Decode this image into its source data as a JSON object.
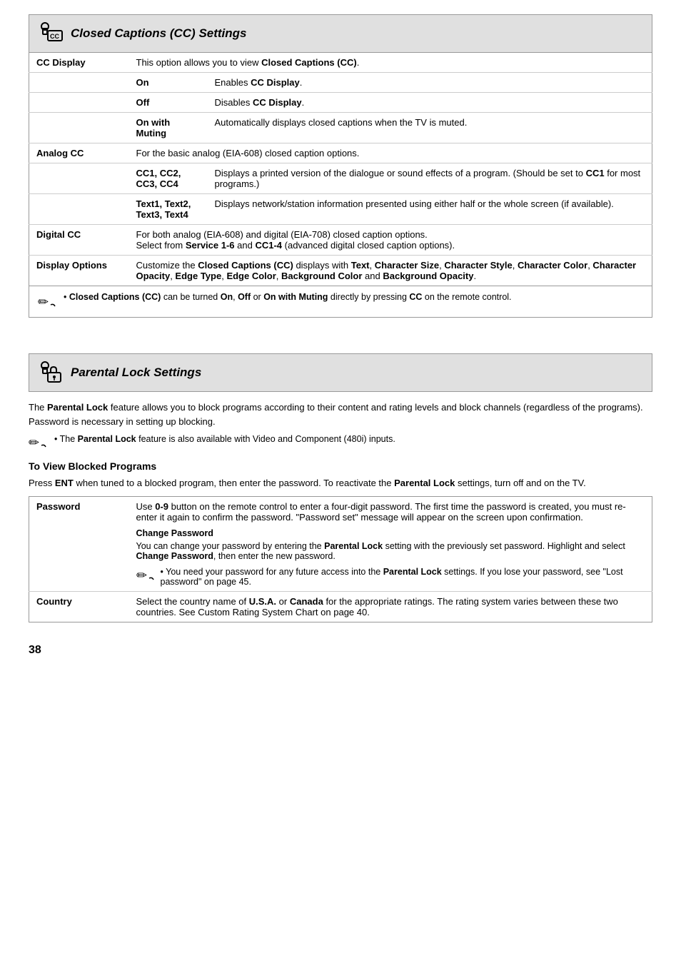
{
  "cc_section": {
    "header_title": "Closed Captions (CC) Settings",
    "rows": [
      {
        "type": "full_label",
        "label": "CC Display",
        "desc": "This option allows you to view <b>Closed Captions (CC)</b>."
      },
      {
        "type": "sub",
        "sub_label": "On",
        "desc": "Enables <b>CC Display</b>."
      },
      {
        "type": "sub",
        "sub_label": "Off",
        "desc": "Disables <b>CC Display</b>."
      },
      {
        "type": "sub",
        "sub_label": "On with Muting",
        "desc": "Automatically displays closed captions when the TV is muted."
      },
      {
        "type": "full_label",
        "label": "Analog CC",
        "desc": "For the basic analog (EIA-608) closed caption options."
      },
      {
        "type": "sub",
        "sub_label": "CC1, CC2, CC3, CC4",
        "desc": "Displays a printed version of the dialogue or sound effects of a program. (Should be set to <b>CC1</b> for most programs.)"
      },
      {
        "type": "sub",
        "sub_label": "Text1, Text2, Text3, Text4",
        "desc": "Displays network/station information presented using either half or the whole screen (if available)."
      },
      {
        "type": "full_label",
        "label": "Digital CC",
        "desc": "For both analog (EIA-608) and digital (EIA-708) closed caption options. Select from <b>Service 1-6</b> and <b>CC1-4</b> (advanced digital closed caption options)."
      },
      {
        "type": "full_label",
        "label": "Display Options",
        "desc": "Customize the <b>Closed Captions (CC)</b> displays with <b>Text</b>, <b>Character Size</b>, <b>Character Style</b>, <b>Character Color</b>, <b>Character Opacity</b>, <b>Edge Type</b>, <b>Edge Color</b>, <b>Background Color</b> and <b>Background Opacity</b>."
      }
    ],
    "note": "• <b>Closed Captions (CC)</b> can be turned <b>On</b>, <b>Off</b> or <b>On with Muting</b> directly by pressing <b>CC</b> on the remote control."
  },
  "parental_section": {
    "header_title": "Parental Lock Settings",
    "intro": "The <b>Parental Lock</b> feature allows you to block programs according to their content and rating levels and block channels (regardless of the programs). Password is necessary in setting up blocking.",
    "note1": "• The <b>Parental Lock</b> feature is also available with Video and Component (480i) inputs.",
    "blocked_title": "To View Blocked Programs",
    "blocked_para": "Press <b>ENT</b> when tuned to a blocked program, then enter the password. To reactivate the <b>Parental Lock</b> settings, turn off and on the TV.",
    "rows": [
      {
        "type": "full_label",
        "label": "Password",
        "desc": "Use <b>0-9</b> button on the remote control to enter a four-digit password. The first time the password is created, you must re-enter it again to confirm the password. \"Password set\" message will appear on the screen upon confirmation.",
        "sub_title": "Change Password",
        "sub_desc": "You can change your password by entering the <b>Parental Lock</b> setting with the previously set password. Highlight and select <b>Change Password</b>, then enter the new password.",
        "note": "• You need your password for any future access into the <b>Parental Lock</b> settings. If you lose your password, see \"Lost password\" on page 45."
      },
      {
        "type": "full_label",
        "label": "Country",
        "desc": "Select the country name of <b>U.S.A.</b> or <b>Canada</b> for the appropriate ratings. The rating system varies between these two countries. See Custom Rating System Chart on page 40."
      }
    ]
  },
  "page_number": "38"
}
